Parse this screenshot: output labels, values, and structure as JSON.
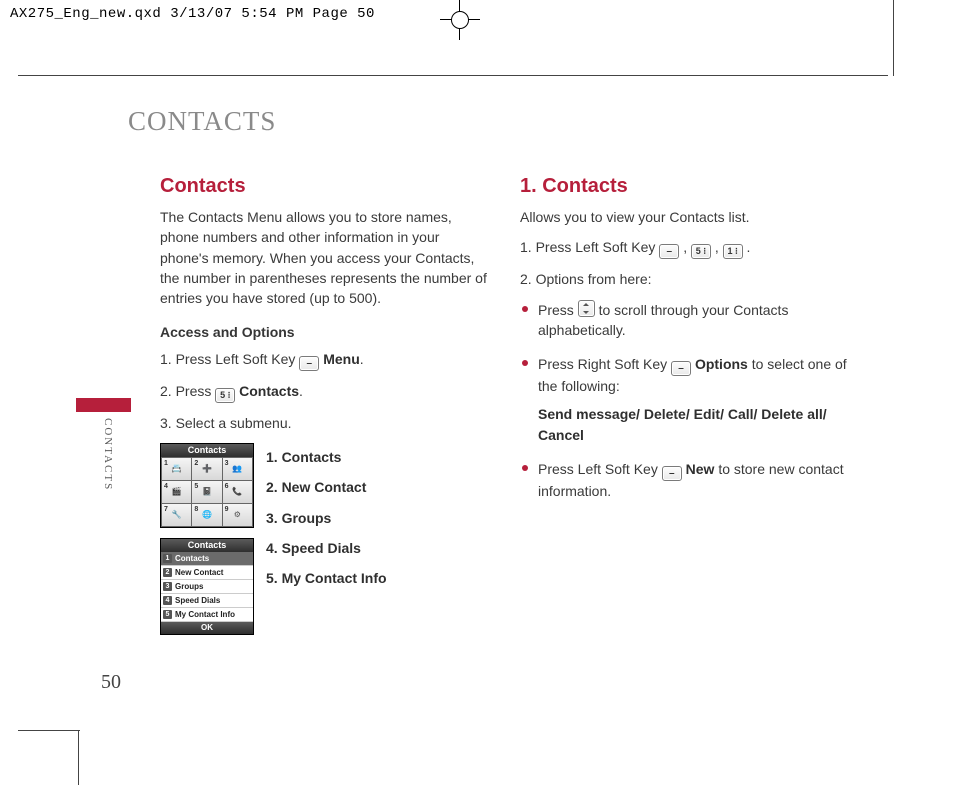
{
  "slug": "AX275_Eng_new.qxd  3/13/07  5:54 PM  Page 50",
  "chapter_title": "CONTACTS",
  "side_label": "CONTACTS",
  "page_number": "50",
  "left": {
    "heading": "Contacts",
    "intro": "The Contacts Menu allows you to store names, phone numbers and other information in your phone's memory. When you access your Contacts, the number in parentheses represents the number of entries you have stored (up to 500).",
    "access_heading": "Access and Options",
    "step1_a": "1.  Press Left Soft Key ",
    "step1_b": " Menu",
    "step1_c": ".",
    "step2_a": "2.  Press ",
    "step2_key": "5 ⁝",
    "step2_b": " Contacts",
    "step2_c": ".",
    "step3": "3.  Select a submenu.",
    "submenu": [
      "1. Contacts",
      "2. New Contact",
      "3. Groups",
      "4. Speed Dials",
      "5. My Contact Info"
    ],
    "shot_title": "Contacts",
    "shot_list": [
      "Contacts",
      "New Contact",
      "Groups",
      "Speed Dials",
      "My Contact Info"
    ],
    "shot_ok": "OK",
    "grid_nums": [
      "1",
      "2",
      "3",
      "4",
      "5",
      "6",
      "7",
      "8",
      "9"
    ]
  },
  "right": {
    "heading": "1. Contacts",
    "intro": "Allows you to view your Contacts list.",
    "step1_a": "1. Press Left Soft Key ",
    "step1_comma": " , ",
    "step1_key1": "5 ⁝",
    "step1_key2": "1 ⁝",
    "step1_end": " .",
    "step2": "2. Options from here:",
    "b1_a": "Press ",
    "b1_b": " to scroll through your Contacts alphabetically.",
    "b2_a": "Press Right Soft Key ",
    "b2_b": " Options",
    "b2_c": " to select one of the following:",
    "b2_options": "Send message/ Delete/ Edit/ Call/ Delete all/ Cancel",
    "b3_a": "Press Left Soft Key ",
    "b3_b": " New",
    "b3_c": " to store new contact information."
  }
}
